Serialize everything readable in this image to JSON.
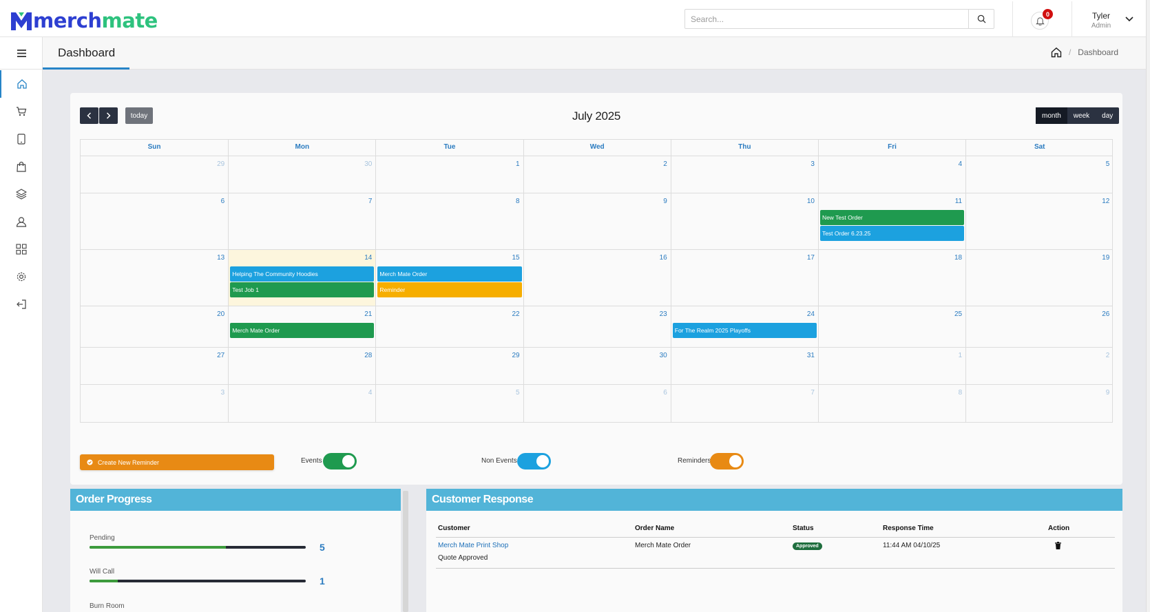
{
  "brand": {
    "part1": "merch",
    "part2": "mate",
    "color1": "#2d3fd1",
    "color2": "#2ec27e"
  },
  "header": {
    "search_placeholder": "Search...",
    "notifications_count": "0",
    "user_name": "Tyler",
    "user_role": "Admin"
  },
  "sidebar": {
    "menu_icon": "menu-icon",
    "items": [
      {
        "icon": "home-icon",
        "active": true
      },
      {
        "icon": "cart-icon"
      },
      {
        "icon": "tablet-icon"
      },
      {
        "icon": "shopping-bag-icon"
      },
      {
        "icon": "layers-icon"
      },
      {
        "icon": "user-icon"
      },
      {
        "icon": "grid-icon"
      },
      {
        "icon": "gear-icon"
      },
      {
        "icon": "logout-icon"
      }
    ]
  },
  "page": {
    "title": "Dashboard",
    "breadcrumb": "Dashboard",
    "separator": "/"
  },
  "calendar": {
    "title": "July 2025",
    "today_label": "today",
    "views": [
      "month",
      "week",
      "day"
    ],
    "active_view": "month",
    "days_of_week": [
      "Sun",
      "Mon",
      "Tue",
      "Wed",
      "Thu",
      "Fri",
      "Sat"
    ],
    "weeks": [
      [
        {
          "d": "29",
          "o": true
        },
        {
          "d": "30",
          "o": true
        },
        {
          "d": "1"
        },
        {
          "d": "2"
        },
        {
          "d": "3"
        },
        {
          "d": "4"
        },
        {
          "d": "5"
        }
      ],
      [
        {
          "d": "6"
        },
        {
          "d": "7"
        },
        {
          "d": "8"
        },
        {
          "d": "9"
        },
        {
          "d": "10"
        },
        {
          "d": "11",
          "events": [
            {
              "t": "New Test Order",
              "c": "green"
            },
            {
              "t": "Test Order 6.23.25",
              "c": "blue"
            }
          ]
        },
        {
          "d": "12"
        }
      ],
      [
        {
          "d": "13"
        },
        {
          "d": "14",
          "today": true,
          "events": [
            {
              "t": "Helping The Community Hoodies",
              "c": "blue"
            },
            {
              "t": "Test Job 1",
              "c": "green"
            }
          ]
        },
        {
          "d": "15",
          "events": [
            {
              "t": "Merch Mate Order",
              "c": "blue"
            },
            {
              "t": "Reminder",
              "c": "yellow"
            }
          ]
        },
        {
          "d": "16"
        },
        {
          "d": "17"
        },
        {
          "d": "18"
        },
        {
          "d": "19"
        }
      ],
      [
        {
          "d": "20"
        },
        {
          "d": "21",
          "events": [
            {
              "t": "Merch Mate Order",
              "c": "green"
            }
          ]
        },
        {
          "d": "22"
        },
        {
          "d": "23"
        },
        {
          "d": "24",
          "events": [
            {
              "t": "For The Realm 2025 Playoffs",
              "c": "blue"
            }
          ]
        },
        {
          "d": "25"
        },
        {
          "d": "26"
        }
      ],
      [
        {
          "d": "27"
        },
        {
          "d": "28"
        },
        {
          "d": "29"
        },
        {
          "d": "30"
        },
        {
          "d": "31"
        },
        {
          "d": "1",
          "o": true
        },
        {
          "d": "2",
          "o": true
        }
      ],
      [
        {
          "d": "3",
          "o": true
        },
        {
          "d": "4",
          "o": true
        },
        {
          "d": "5",
          "o": true
        },
        {
          "d": "6",
          "o": true
        },
        {
          "d": "7",
          "o": true
        },
        {
          "d": "8",
          "o": true
        },
        {
          "d": "9",
          "o": true
        }
      ]
    ],
    "create_reminder_label": "Create New Reminder",
    "toggles": [
      {
        "label": "Events",
        "color": "#1f9a4f",
        "on": true
      },
      {
        "label": "Non Events",
        "color": "#1ca1df",
        "on": true
      },
      {
        "label": "Reminders",
        "color": "#e88a14",
        "on": true
      }
    ]
  },
  "order_progress": {
    "title": "Order Progress",
    "items": [
      {
        "label": "Pending",
        "value": "5",
        "fraction": 0.63
      },
      {
        "label": "Will Call",
        "value": "1",
        "fraction": 0.13
      },
      {
        "label": "Burn Room",
        "value": "",
        "fraction": 0
      }
    ]
  },
  "customer_response": {
    "title": "Customer Response",
    "columns": [
      "Customer",
      "Order Name",
      "Status",
      "Response Time",
      "Action"
    ],
    "rows": [
      {
        "customer": "Merch Mate Print Shop",
        "note": "Quote Approved",
        "order": "Merch Mate Order",
        "status": "Approved",
        "time": "11:44 AM 04/10/25",
        "action_icon": "trash-icon"
      }
    ]
  }
}
